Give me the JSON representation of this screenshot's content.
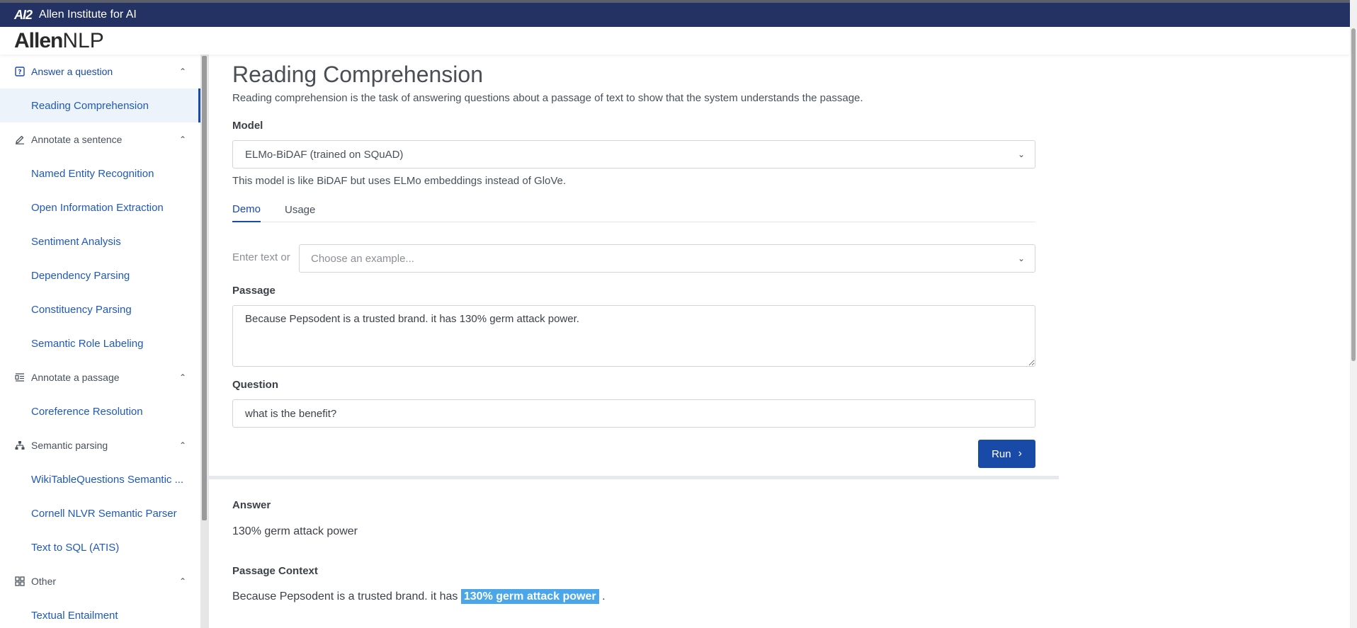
{
  "topbar": {
    "logo": "AI2",
    "name": "Allen Institute for AI"
  },
  "brand": {
    "bold": "Allen",
    "light": "NLP"
  },
  "sidebar": {
    "groups": [
      {
        "label": "Answer a question",
        "icon": "question-box-icon",
        "items": [
          "Reading Comprehension"
        ]
      },
      {
        "label": "Annotate a sentence",
        "icon": "pencil-icon",
        "items": [
          "Named Entity Recognition",
          "Open Information Extraction",
          "Sentiment Analysis",
          "Dependency Parsing",
          "Constituency Parsing",
          "Semantic Role Labeling"
        ]
      },
      {
        "label": "Annotate a passage",
        "icon": "passage-icon",
        "items": [
          "Coreference Resolution"
        ]
      },
      {
        "label": "Semantic parsing",
        "icon": "tree-icon",
        "items": [
          "WikiTableQuestions Semantic ...",
          "Cornell NLVR Semantic Parser",
          "Text to SQL (ATIS)"
        ]
      },
      {
        "label": "Other",
        "icon": "grid-icon",
        "items": [
          "Textual Entailment"
        ]
      }
    ]
  },
  "main": {
    "title": "Reading Comprehension",
    "description": "Reading comprehension is the task of answering questions about a passage of text to show that the system understands the passage.",
    "model_label": "Model",
    "model_selected": "ELMo-BiDAF (trained on SQuAD)",
    "model_note": "This model is like BiDAF but uses ELMo embeddings instead of GloVe.",
    "tabs": [
      "Demo",
      "Usage"
    ],
    "enter_text": "Enter text or",
    "example_placeholder": "Choose an example...",
    "passage_label": "Passage",
    "passage_value": "Because Pepsodent is a trusted brand. it has 130% germ attack power.",
    "question_label": "Question",
    "question_value": "what is the benefit?",
    "run_label": "Run",
    "answer_label": "Answer",
    "answer_value": "130% germ attack power",
    "context_label": "Passage Context",
    "context_before": "Because Pepsodent is a trusted brand. it has ",
    "context_highlight": "130% germ attack power",
    "context_after": " ."
  },
  "colors": {
    "primary": "#1a4aa8",
    "topbar": "#243263",
    "highlight": "#4aa6e8"
  }
}
